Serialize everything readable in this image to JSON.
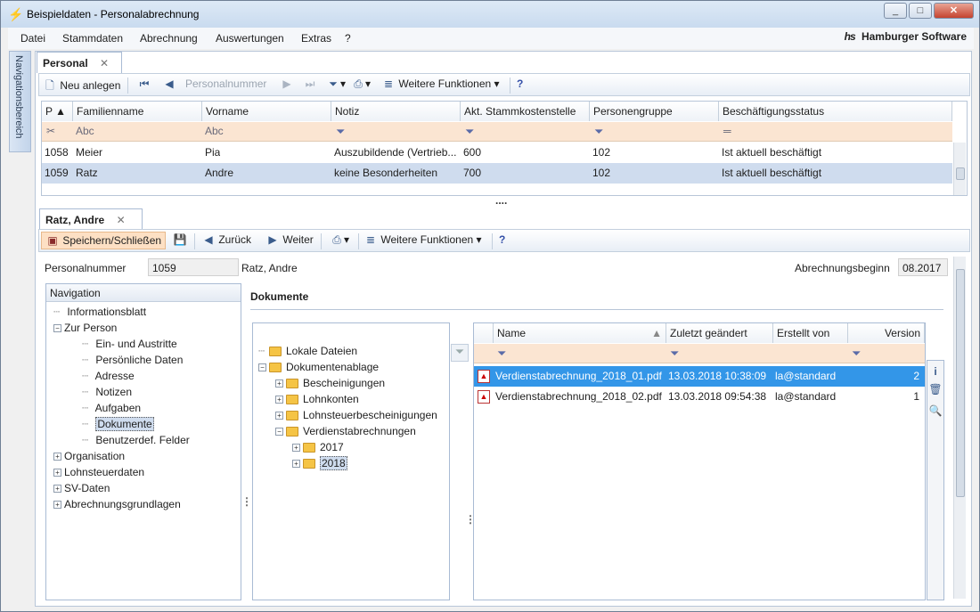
{
  "window": {
    "title": "Beispieldaten - Personalabrechnung",
    "controls": [
      "_",
      "□",
      "✕"
    ]
  },
  "menu": {
    "items": [
      "Datei",
      "Stammdaten",
      "Abrechnung",
      "Auswertungen",
      "Extras",
      "?"
    ],
    "brand": "Hamburger Software",
    "brand_logo": "hs"
  },
  "nav_strip": {
    "label": "Navigationsbereich"
  },
  "tab_top": {
    "label": "Personal",
    "close": "✕"
  },
  "toolbar_top": {
    "new": "Neu anlegen",
    "search_placeholder": "Personalnummer",
    "more": "Weitere Funktionen"
  },
  "grid": {
    "columns": [
      "P",
      "Familienname",
      "Vorname",
      "Notiz",
      "Akt. Stammkostenstelle",
      "Personengruppe",
      "Beschäftigungsstatus"
    ],
    "filter_text": "Abc",
    "rows": [
      {
        "p": "1058",
        "family": "Meier",
        "first": "Pia",
        "note": "Auszubildende (Vertrieb...",
        "cost": "600",
        "group": "102",
        "status": "Ist aktuell beschäftigt"
      },
      {
        "p": "1059",
        "family": "Ratz",
        "first": "Andre",
        "note": "keine Besonderheiten",
        "cost": "700",
        "group": "102",
        "status": "Ist aktuell beschäftigt"
      }
    ],
    "splitter": "...."
  },
  "tab_detail": {
    "label": "Ratz, Andre",
    "close": "✕"
  },
  "toolbar_detail": {
    "save_close": "Speichern/Schließen",
    "back": "Zurück",
    "forward": "Weiter",
    "more": "Weitere Funktionen"
  },
  "person": {
    "number_label": "Personalnummer",
    "number": "1059",
    "name": "Ratz, Andre",
    "start_label": "Abrechnungsbeginn",
    "start": "08.2017"
  },
  "navigation": {
    "title": "Navigation",
    "items": [
      {
        "label": "Informationsblatt",
        "level": 1
      },
      {
        "label": "Zur Person",
        "level": 1,
        "expanded": true
      },
      {
        "label": "Ein- und Austritte",
        "level": 2
      },
      {
        "label": "Persönliche Daten",
        "level": 2
      },
      {
        "label": "Adresse",
        "level": 2
      },
      {
        "label": "Notizen",
        "level": 2
      },
      {
        "label": "Aufgaben",
        "level": 2
      },
      {
        "label": "Dokumente",
        "level": 2,
        "selected": true
      },
      {
        "label": "Benutzerdef. Felder",
        "level": 2
      },
      {
        "label": "Organisation",
        "level": 1,
        "collapsed": true
      },
      {
        "label": "Lohnsteuerdaten",
        "level": 1,
        "collapsed": true
      },
      {
        "label": "SV-Daten",
        "level": 1,
        "collapsed": true
      },
      {
        "label": "Abrechnungsgrundlagen",
        "level": 1,
        "collapsed": true
      }
    ]
  },
  "documents": {
    "title": "Dokumente",
    "folders": [
      {
        "label": "Lokale Dateien",
        "level": 0
      },
      {
        "label": "Dokumentenablage",
        "level": 0,
        "expanded": true
      },
      {
        "label": "Bescheinigungen",
        "level": 1,
        "collapsed": true
      },
      {
        "label": "Lohnkonten",
        "level": 1,
        "collapsed": true
      },
      {
        "label": "Lohnsteuerbescheinigungen",
        "level": 1,
        "collapsed": true
      },
      {
        "label": "Verdienstabrechnungen",
        "level": 1,
        "expanded": true
      },
      {
        "label": "2017",
        "level": 2,
        "collapsed": true
      },
      {
        "label": "2018",
        "level": 2,
        "collapsed": true,
        "selected": true
      }
    ],
    "file_columns": [
      "Name",
      "Zuletzt geändert",
      "Erstellt von",
      "Version"
    ],
    "files": [
      {
        "name": "Verdienstabrechnung_2018_01.pdf",
        "modified": "13.03.2018 10:38:09",
        "author": "la@standard",
        "version": "2"
      },
      {
        "name": "Verdienstabrechnung_2018_02.pdf",
        "modified": "13.03.2018 09:54:38",
        "author": "la@standard",
        "version": "1"
      }
    ]
  },
  "colors": {
    "selection": "#3396e8",
    "row_selected": "#cfdcee",
    "filter_row": "#fbe5d2",
    "save_button": "#fde0c4"
  }
}
